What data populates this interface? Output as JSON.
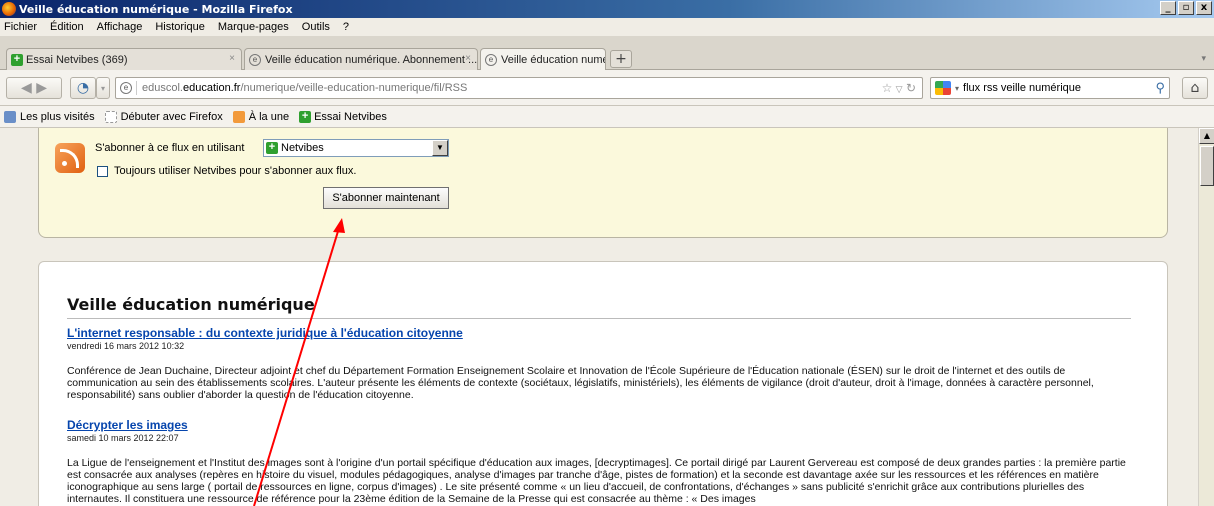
{
  "window": {
    "title": "Veille éducation numérique - Mozilla Firefox",
    "min": "_",
    "max": "ð",
    "close": "x"
  },
  "menu": [
    "Fichier",
    "Édition",
    "Affichage",
    "Historique",
    "Marque-pages",
    "Outils",
    "?"
  ],
  "tabs": [
    {
      "label": "Essai Netvibes (369)",
      "close": "×"
    },
    {
      "label": "Veille éducation numérique. Abonnement ...",
      "close": "×"
    },
    {
      "label": "Veille éducation numérique",
      "close": "×"
    }
  ],
  "newtab": "+",
  "nav": {
    "url_prefix": "eduscol.",
    "url_domain": "education.fr",
    "url_path": "/numerique/veille-education-numerique/fil/RSS",
    "search_value": "flux rss veille numérique"
  },
  "bookmarks": [
    "Les plus visités",
    "Débuter avec Firefox",
    "À la une",
    "Essai Netvibes"
  ],
  "subscribe": {
    "label": "S'abonner à ce flux en utilisant",
    "reader": "Netvibes",
    "always_label": "Toujours utiliser Netvibes pour s'abonner aux flux.",
    "button": "S'abonner maintenant"
  },
  "feed": {
    "title": "Veille éducation numérique",
    "entries": [
      {
        "title": "L'internet responsable : du contexte juridique à l'éducation citoyenne",
        "date": "vendredi 16 mars 2012 10:32",
        "body": "Conférence de Jean Duchaine, Directeur adjoint et chef du Département Formation Enseignement Scolaire et Innovation de l'École Supérieure de l'Éducation nationale (ÉSEN) sur le droit de l'internet et des outils de communication au sein des établissements scolaires. L'auteur présente les éléments de contexte (sociétaux, législatifs, ministériels), les éléments de vigilance (droit d'auteur, droit à l'image, données à caractère personnel, responsabilité) sans oublier d'aborder la question de l'éducation citoyenne."
      },
      {
        "title": "Décrypter les images",
        "date": "samedi 10 mars 2012 22:07",
        "body": "La Ligue de l'enseignement et l'Institut des images sont à l'origine d'un portail spécifique d'éducation aux images, [decryptimages]. Ce portail dirigé par Laurent Gervereau est composé de deux grandes parties : la première partie est consacrée aux analyses (repères en histoire du visuel, modules pédagogiques, analyse d'images par tranche d'âge, pistes de formation) et la seconde est davantage axée sur les ressources et les références en matière iconographique au sens large ( portail de ressources en ligne, corpus d'images) . Le site présenté comme « un lieu d'accueil, de confrontations, d'échanges » sans publicité s'enrichit grâce aux contributions plurielles des internautes. Il constituera une ressource de référence pour la 23ème édition de la Semaine de la Presse qui est consacrée au thème : « Des images"
      }
    ]
  },
  "colors": {
    "arrow": "#ff0000",
    "link": "#0645ad",
    "subscribe_bg": "#fbf9dc"
  }
}
